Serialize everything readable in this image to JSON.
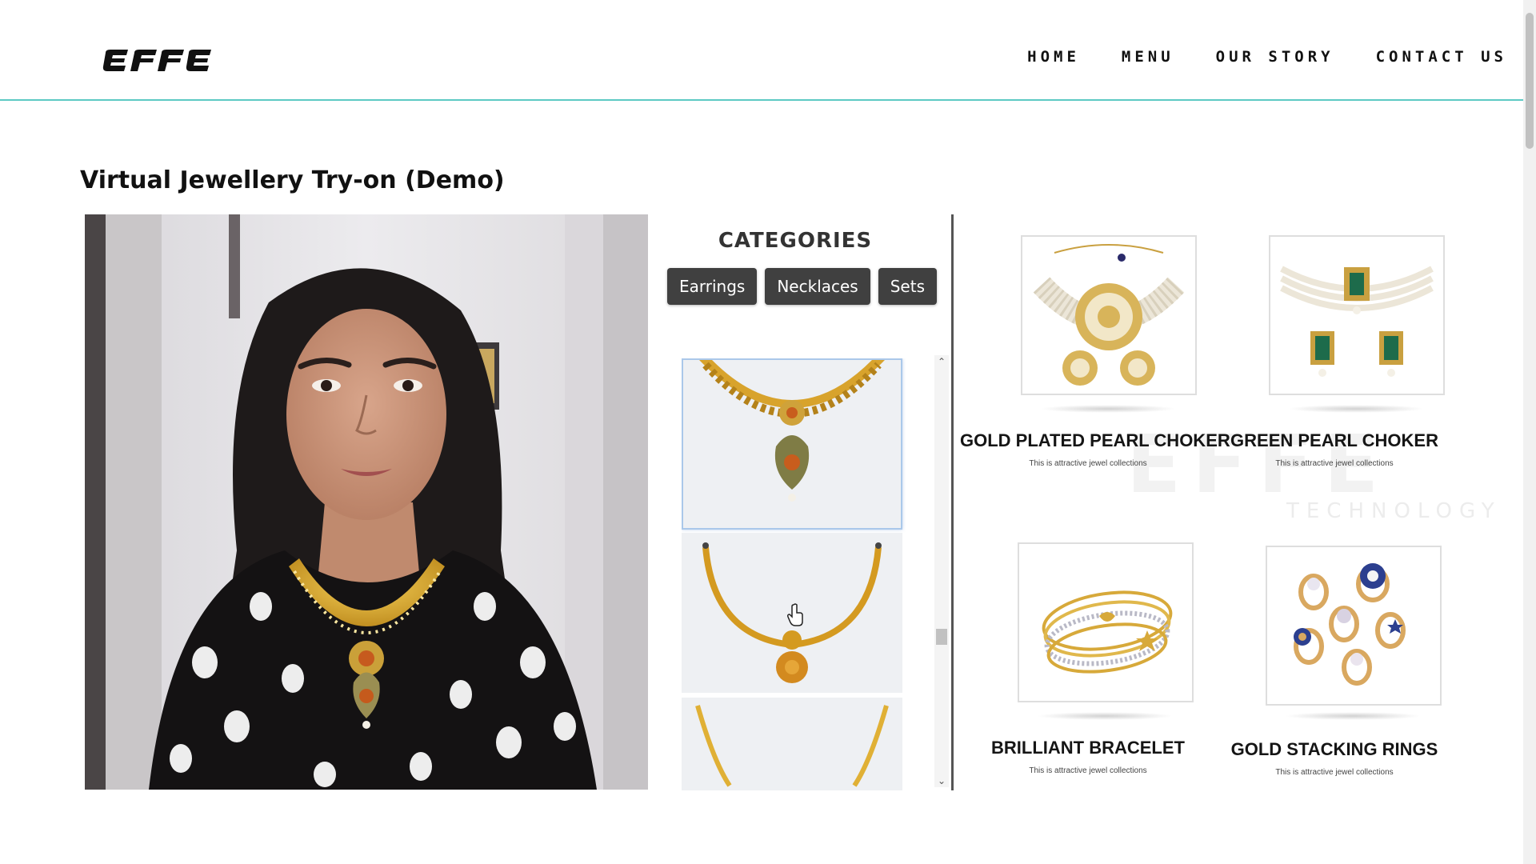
{
  "header": {
    "logo_text": "EFFE",
    "nav": [
      {
        "label": "HOME"
      },
      {
        "label": "MENU"
      },
      {
        "label": "OUR STORY"
      },
      {
        "label": "CONTACT US"
      }
    ]
  },
  "page": {
    "title": "Virtual Jewellery Try-on (Demo)"
  },
  "categories": {
    "title": "CATEGORIES",
    "buttons": [
      {
        "label": "Earrings"
      },
      {
        "label": "Necklaces"
      },
      {
        "label": "Sets"
      }
    ]
  },
  "watermark": {
    "logo": "EFFE",
    "sub": "TECHNOLOGY"
  },
  "products": [
    {
      "title": "GOLD PLATED PEARL CHOKER",
      "subtitle": "This is attractive jewel collections"
    },
    {
      "title": "GREEN PEARL CHOKER",
      "subtitle": "This is attractive jewel collections"
    },
    {
      "title": "BRILLIANT BRACELET",
      "subtitle": "This is attractive jewel collections"
    },
    {
      "title": "GOLD STACKING RINGS",
      "subtitle": "This is attractive jewel collections"
    }
  ],
  "colors": {
    "accent": "#5cc9c4",
    "button_bg": "#404040",
    "gold": "#d9a62a"
  }
}
